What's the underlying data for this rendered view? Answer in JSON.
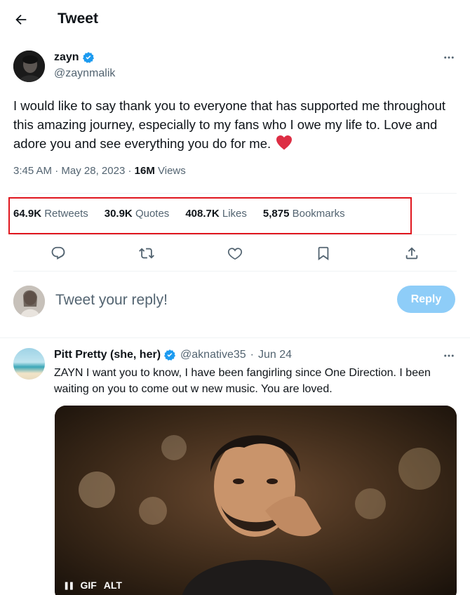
{
  "header": {
    "title": "Tweet",
    "back_icon": "arrow-left-icon"
  },
  "tweet": {
    "author_name": "zayn",
    "author_handle": "@zaynmalik",
    "verified": true,
    "text": "I would like to say thank you to everyone that has supported me throughout this amazing journey, especially to my fans who I owe my life to. Love and adore you and see everything you do for me.",
    "emoji": "red-heart",
    "time": "3:45 AM",
    "date": "May 28, 2023",
    "views_count": "16M",
    "views_label": "Views",
    "stats": [
      {
        "count": "64.9K",
        "label": "Retweets"
      },
      {
        "count": "30.9K",
        "label": "Quotes"
      },
      {
        "count": "408.7K",
        "label": "Likes"
      },
      {
        "count": "5,875",
        "label": "Bookmarks"
      }
    ],
    "actions": [
      "reply-icon",
      "retweet-icon",
      "like-icon",
      "bookmark-icon",
      "share-icon"
    ]
  },
  "composer": {
    "placeholder": "Tweet your reply!",
    "button_label": "Reply"
  },
  "reply": {
    "author_name": "Pitt Pretty (she, her)",
    "author_handle": "@aknative35",
    "separator": "·",
    "date": "Jun 24",
    "verified": true,
    "text": "ZAYN I want you to know, I have been fangirling  since One Direction. I been waiting on you to come out w new music. You are loved.",
    "media_controls": {
      "pause": "❚❚",
      "gif": "GIF",
      "alt": "ALT"
    }
  },
  "colors": {
    "accent": "#1d9bf0",
    "reply_button": "#8ecdf8",
    "highlight_border": "#e0161e",
    "secondary_text": "#536471",
    "heart": "#f91880"
  }
}
